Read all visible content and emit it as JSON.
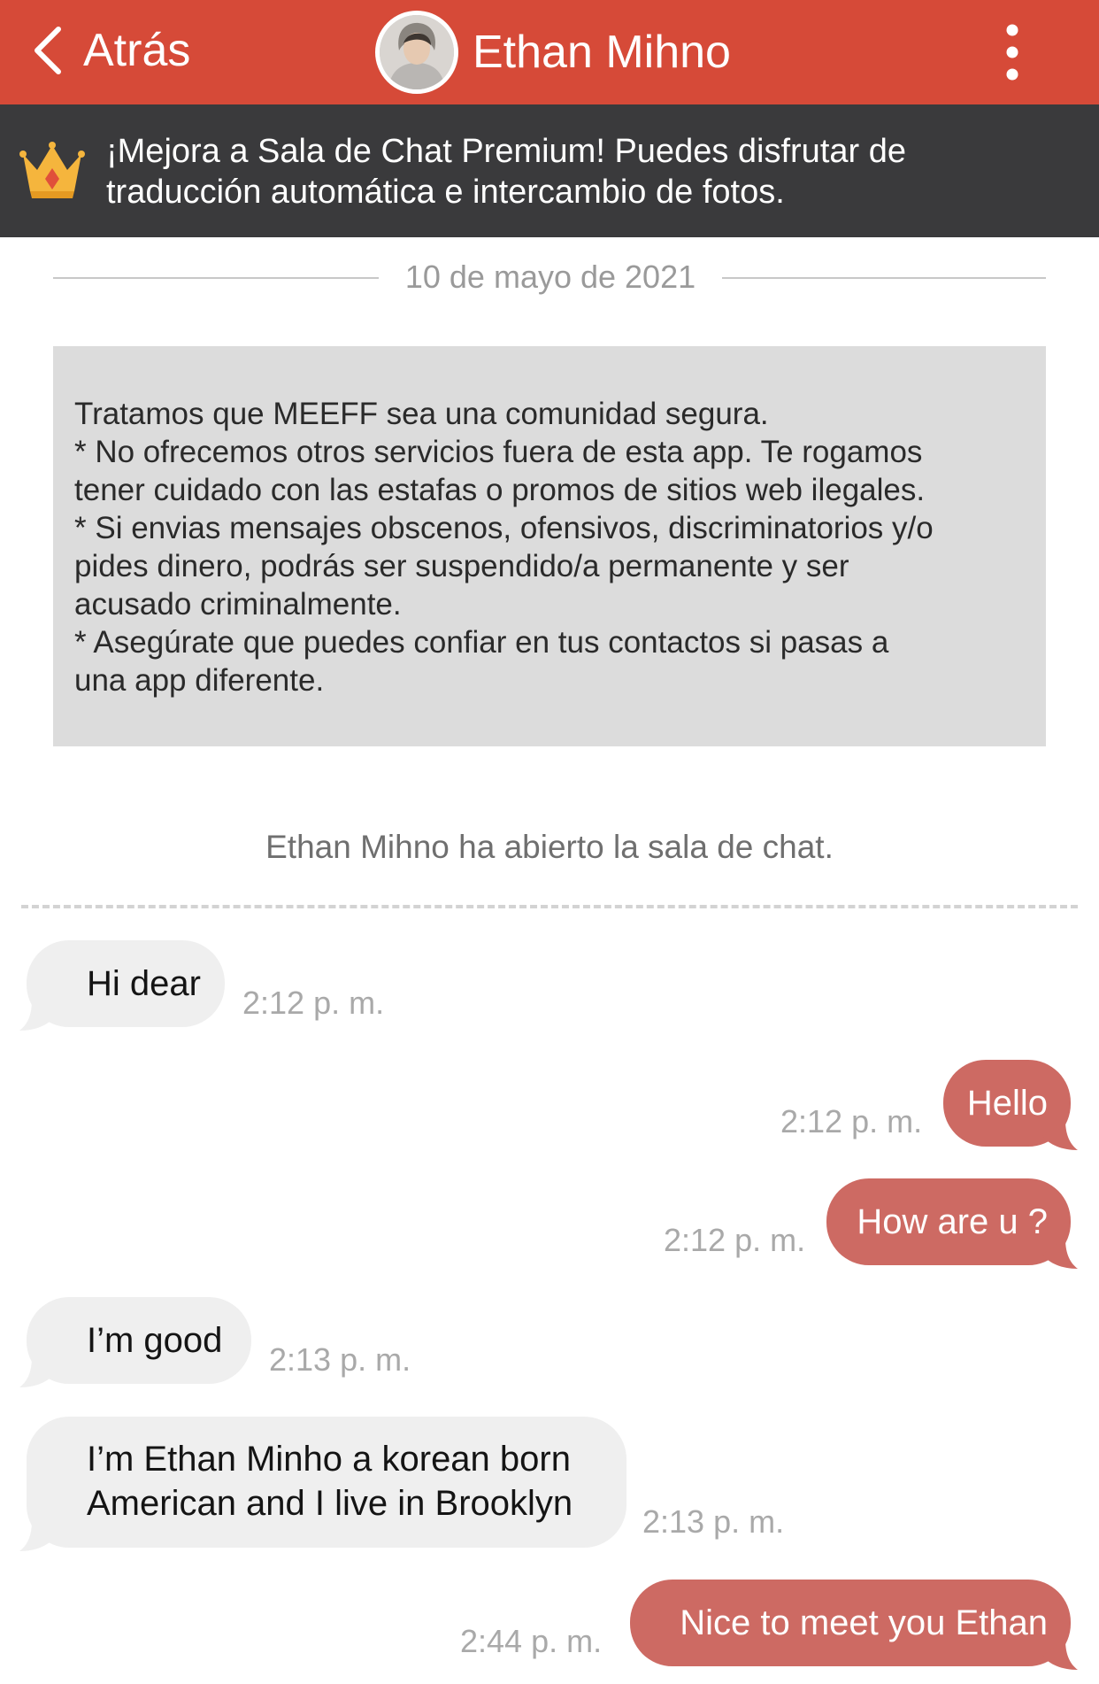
{
  "nav": {
    "back_label": "Atrás",
    "title": "Ethan Mihno",
    "bar_color": "#d64a38"
  },
  "premium": {
    "line1": "¡Mejora a Sala de Chat Premium! Puedes disfrutar de",
    "line2": "traducción automática e intercambio de fotos.",
    "icon": "crown-icon"
  },
  "date_divider": "10 de mayo de 2021",
  "notice": {
    "lines": [
      "Tratamos que MEEFF sea una comunidad segura.",
      "* No ofrecemos otros servicios fuera de esta app. Te rogamos",
      "tener cuidado con las estafas o promos de sitios web ilegales.",
      "* Si envias mensajes obscenos, ofensivos, discriminatorios y/o",
      "pides dinero, podrás ser suspendido/a permanente y ser",
      "acusado criminalmente.",
      "* Asegúrate que puedes confiar en tus contactos si pasas a",
      "una app diferente."
    ]
  },
  "system_message": "Ethan Mihno ha abierto la sala de chat.",
  "messages": [
    {
      "direction": "in",
      "lines": [
        "Hi dear"
      ],
      "time": "2:12 p. m."
    },
    {
      "direction": "out",
      "lines": [
        "Hello"
      ],
      "time": "2:12 p. m."
    },
    {
      "direction": "out",
      "lines": [
        "How are u ?"
      ],
      "time": "2:12 p. m."
    },
    {
      "direction": "in",
      "lines": [
        "I’m good"
      ],
      "time": "2:13 p. m."
    },
    {
      "direction": "in",
      "lines": [
        "I’m Ethan Minho a korean born",
        "American and I live in Brooklyn"
      ],
      "time": "2:13 p. m."
    },
    {
      "direction": "out",
      "lines": [
        "Nice to meet you Ethan"
      ],
      "time": "2:44 p. m."
    }
  ],
  "colors": {
    "incoming_bubble": "#efefef",
    "outgoing_bubble": "#cd6a63",
    "premium_banner": "#3a3a3c"
  }
}
